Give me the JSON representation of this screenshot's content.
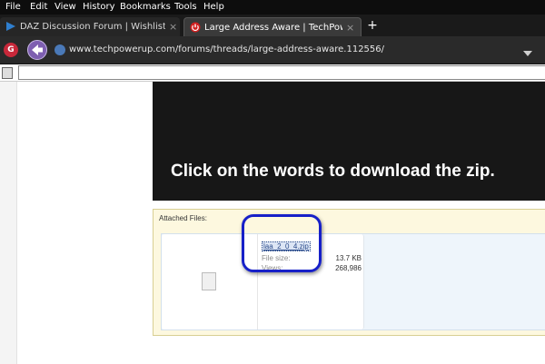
{
  "menubar": {
    "items": [
      {
        "label": "File"
      },
      {
        "label": "Edit"
      },
      {
        "label": "View"
      },
      {
        "label": "History"
      },
      {
        "label": "Bookmarks"
      },
      {
        "label": "Tools"
      },
      {
        "label": "Help"
      }
    ]
  },
  "tabs": [
    {
      "title": "DAZ Discussion Forum | Wishlist...",
      "close": "×"
    },
    {
      "title": "Large Address Aware | TechPowe...",
      "close": "×"
    }
  ],
  "new_tab_label": "+",
  "navbar": {
    "url": "www.techpowerup.com/forums/threads/large-address-aware.112556/",
    "gbutton_label": "G"
  },
  "page": {
    "banner_text": "Click on the words to download the zip.",
    "attached_files_label": "Attached Files:",
    "file": {
      "name": "laa_2_0_4.zip",
      "size_label": "File size:",
      "size_value": "13.7 KB",
      "views_label": "Views:",
      "views_value": "268,986"
    }
  },
  "colors": {
    "highlight_border": "#1720c8",
    "banner_bg": "#171717",
    "attach_bg": "#fdf8df"
  },
  "icons": [
    "tab-favicon-daz-icon",
    "tab-favicon-techpowerup-icon",
    "back-arrow-icon",
    "globe-icon",
    "bookmark-page-icon",
    "document-icon"
  ]
}
